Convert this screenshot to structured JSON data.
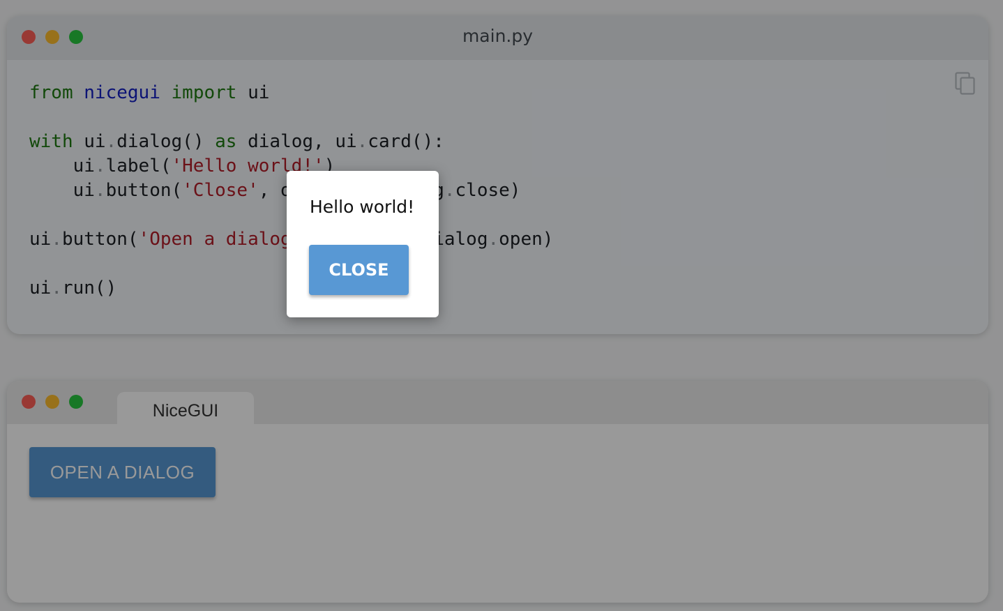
{
  "code_window": {
    "title": "main.py",
    "copy_icon": "copy-icon",
    "code_lines": [
      "from nicegui import ui",
      "",
      "with ui.dialog() as dialog, ui.card():",
      "    ui.label('Hello world!')",
      "    ui.button('Close', on_click=dialog.close)",
      "",
      "ui.button('Open a dialog', on_click=dialog.open)",
      "",
      "ui.run()"
    ]
  },
  "app_window": {
    "tab_label": "NiceGUI",
    "open_button_label": "OPEN A DIALOG"
  },
  "dialog": {
    "label": "Hello world!",
    "close_button_label": "CLOSE"
  },
  "colors": {
    "traffic_red": "#ff5f57",
    "traffic_yellow": "#febc2e",
    "traffic_green": "#28c840",
    "button_primary": "#5898d4",
    "keyword_green": "#1f7a12",
    "module_blue": "#1521c4",
    "string_red": "#b31d28"
  }
}
